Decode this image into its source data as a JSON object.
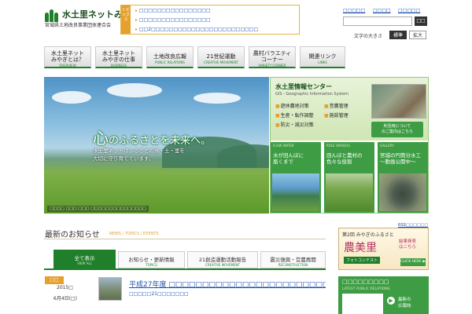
{
  "header": {
    "logo_text": "水土里ネットみやぎ",
    "logo_sub": "宮城県土地改良事業団体連合会",
    "topics_label": "トピックス",
    "topics": [
      "□□□□□□□□□□□□□□□□",
      "□□□□□□□□□□□□□□□□",
      "□□2□□□□□□□□□□□□□□□□□□□□□□□□"
    ],
    "util_links": [
      "□□□□□",
      "□□□□",
      "□□□□□"
    ],
    "search_button": "□□",
    "font_size_label": "文字の大きさ",
    "font_size_normal": "標準",
    "font_size_large": "拡大"
  },
  "nav": [
    {
      "label": "水土里ネット\nみやぎとは？",
      "en": "OVERVIEW"
    },
    {
      "label": "水土里ネット\nみやぎの仕事",
      "en": "BUSINESS"
    },
    {
      "label": "土地改良広報",
      "en": "PUBLIC RELATIONS"
    },
    {
      "label": "21世紀運動",
      "en": "CREATIVE MOVEMENT"
    },
    {
      "label": "農村バラエティ\nコーナー",
      "en": "VARIETY CORNER"
    },
    {
      "label": "関連リンク",
      "en": "LINKS"
    }
  ],
  "hero": {
    "headline_big": "心",
    "headline": "のふるさとを未来へ。",
    "sub": "水土里ネットはふるさとの水・土・里を\n大切に守り育てています。",
    "caption": "□□□□ □□□ □□□ □□□□□□□□□□□□□□□"
  },
  "gis": {
    "title": "水土里情報センター",
    "subtitle": "GIS - Geographic Information System",
    "items": [
      "遊休農地対策",
      "営農管理",
      "生産・転作調整",
      "施設管理",
      "防災・減災対策"
    ],
    "button": "利活用について\nのご案内はこちら"
  },
  "cards": [
    {
      "tag": "FLOW WATER",
      "text": "水が田んぼに\n届くまで"
    },
    {
      "tag": "ROLE VARIOUS",
      "text": "田んぼと農村の\n色々な役割"
    },
    {
      "tag": "GALLERY",
      "text": "宮城の円筒分水工\n〜動画公開中〜"
    }
  ],
  "news": {
    "title": "最新のお知らせ",
    "subtitle": "NEWS / TOPICS / EVENTS",
    "rss": "RSS□□□□□□",
    "tabs": [
      {
        "label": "全て表示",
        "en": "VIEW ALL"
      },
      {
        "label": "お知らせ・更新情報",
        "en": "TOPICS"
      },
      {
        "label": "21創造運動活動報告",
        "en": "CREATIVE MOVEMENT"
      },
      {
        "label": "震災復興・営農再開",
        "en": "RECONSTRUCTION"
      }
    ],
    "item": {
      "tag": "□□",
      "year": "2015□",
      "date": "6月4日(□)",
      "title": "平成27年度 □□□□□□□□□□□□□□□□□□□□□□□□□□",
      "category": "□□□□□21□□□□□□□"
    }
  },
  "sidebar": {
    "banner_line1": "第2回 みやぎのふるさと",
    "banner_title": "農美里",
    "banner_contest": "フォトコンテスト",
    "banner_result": "結果発表\nはこちら",
    "banner_click": "CLICK HERE ▶",
    "pr_title": "□□□□□□□□□",
    "pr_sub": "LATEST PUBLIC RELATIONS",
    "pr_link": "最新の\n広報誌"
  }
}
